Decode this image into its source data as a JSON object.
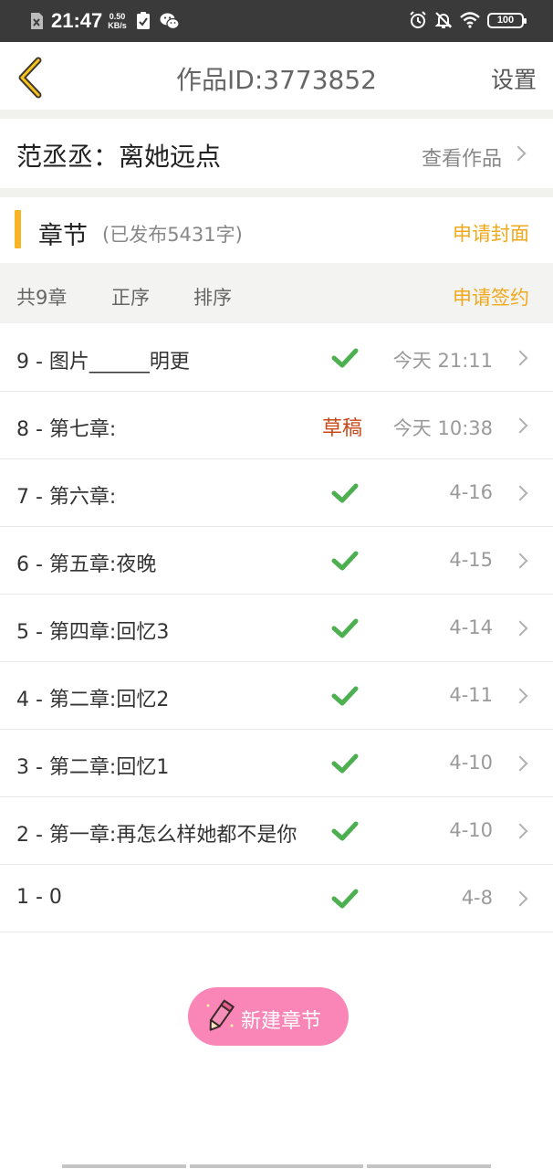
{
  "status_bar": {
    "time": "21:47",
    "speed_value": "0.50",
    "speed_unit": "KB/s",
    "battery": "100",
    "icons": [
      "sim-x-icon",
      "clipboard-check-icon",
      "wechat-icon",
      "alarm-icon",
      "bell-off-icon",
      "wifi-icon",
      "battery-icon"
    ]
  },
  "header": {
    "title": "作品ID:3773852",
    "settings_label": "设置",
    "back_icon": "chevron-left-icon"
  },
  "work": {
    "title": "范丞丞：离她远点",
    "view_link": "查看作品"
  },
  "chapters_header": {
    "title": "章节",
    "published": "(已发布5431字)",
    "apply_cover": "申请封面"
  },
  "toolbar": {
    "count": "共9章",
    "order": "正序",
    "sort": "排序",
    "apply_sign": "申请签约"
  },
  "chapters": [
    {
      "title": "9 - 图片______明更",
      "status": "published",
      "date": "今天 21:11"
    },
    {
      "title": "8 - 第七章:",
      "status": "draft",
      "status_label": "草稿",
      "date": "今天 10:38"
    },
    {
      "title": "7 - 第六章:",
      "status": "published",
      "date": "4-16"
    },
    {
      "title": "6 - 第五章:夜晚",
      "status": "published",
      "date": "4-15"
    },
    {
      "title": "5 - 第四章:回忆3",
      "status": "published",
      "date": "4-14"
    },
    {
      "title": "4 - 第二章:回忆2",
      "status": "published",
      "date": "4-11"
    },
    {
      "title": "3 - 第二章:回忆1",
      "status": "published",
      "date": "4-10"
    },
    {
      "title": "2 - 第一章:再怎么样她都不是你",
      "status": "published",
      "date": "4-10"
    },
    {
      "title": "1 - 0",
      "status": "published",
      "date": "4-8"
    }
  ],
  "new_chapter": {
    "label": "新建章节",
    "icon": "pencil-icon"
  },
  "colors": {
    "accent": "#f0a81c",
    "check": "#4caf50",
    "draft": "#c84818",
    "button": "#f986b7"
  }
}
